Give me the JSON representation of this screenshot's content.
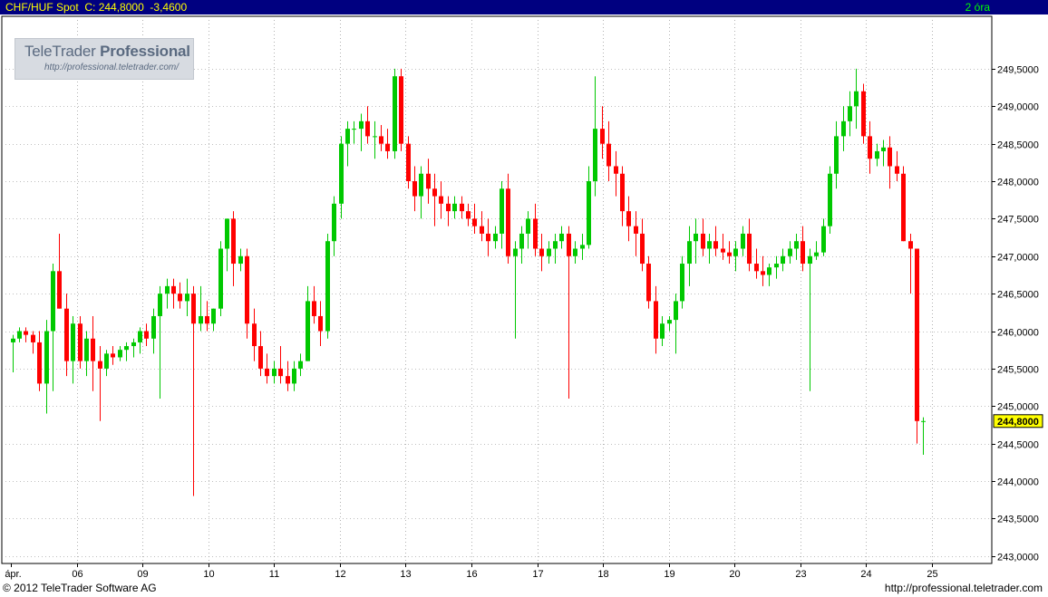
{
  "header": {
    "symbol": "CHF/HUF Spot",
    "close": "C: 244,8000",
    "change": "-3,4600",
    "interval": "2 óra"
  },
  "watermark": {
    "brand_light": "TeleTrader ",
    "brand_bold": "Professional",
    "url": "http://professional.teletrader.com/"
  },
  "footer": {
    "copyright": "© 2012  TeleTrader Software AG",
    "site": "http://professional.teletrader.com"
  },
  "colors": {
    "header_bg": "#000080",
    "header_text": "#ffff00",
    "up": "#00c800",
    "down": "#ff0000",
    "grid": "#808080",
    "axis_bg": "#ffffff",
    "last_price_bg": "#ffff00"
  },
  "chart_data": {
    "type": "candlestick",
    "title": "CHF/HUF Spot",
    "interval": "2 óra",
    "x_ticks": [
      "ápr.",
      "06",
      "09",
      "10",
      "11",
      "12",
      "13",
      "16",
      "17",
      "18",
      "19",
      "20",
      "23",
      "24",
      "25"
    ],
    "y_ticks": [
      "243,0000",
      "243,5000",
      "244,0000",
      "244,5000",
      "245,0000",
      "245,5000",
      "246,0000",
      "246,5000",
      "247,0000",
      "247,5000",
      "248,0000",
      "248,5000",
      "249,0000",
      "249,5000"
    ],
    "y_tick_values": [
      243.0,
      243.5,
      244.0,
      244.5,
      245.0,
      245.5,
      246.0,
      246.5,
      247.0,
      247.5,
      248.0,
      248.5,
      249.0,
      249.5
    ],
    "ylim": [
      242.9,
      250.2
    ],
    "last_price": 244.8,
    "last_price_label": "244,8000",
    "grid": true,
    "candles": [
      [
        245.85,
        245.95,
        245.45,
        245.9
      ],
      [
        245.9,
        246.05,
        245.85,
        246.0
      ],
      [
        246.0,
        246.05,
        245.85,
        245.95
      ],
      [
        245.95,
        246.0,
        245.7,
        245.85
      ],
      [
        245.85,
        246.0,
        245.2,
        245.3
      ],
      [
        245.3,
        246.15,
        244.9,
        246.0
      ],
      [
        246.0,
        246.9,
        245.2,
        246.8
      ],
      [
        246.8,
        247.3,
        246.3,
        246.3
      ],
      [
        246.3,
        246.5,
        245.4,
        245.6
      ],
      [
        245.6,
        246.2,
        245.3,
        246.1
      ],
      [
        246.1,
        246.2,
        245.5,
        245.6
      ],
      [
        245.6,
        246.0,
        245.4,
        245.9
      ],
      [
        245.9,
        246.2,
        245.2,
        245.6
      ],
      [
        245.6,
        245.8,
        244.8,
        245.5
      ],
      [
        245.5,
        245.75,
        245.4,
        245.7
      ],
      [
        245.7,
        245.8,
        245.55,
        245.65
      ],
      [
        245.65,
        245.8,
        245.6,
        245.75
      ],
      [
        245.75,
        245.85,
        245.6,
        245.8
      ],
      [
        245.8,
        245.9,
        245.65,
        245.85
      ],
      [
        245.85,
        246.05,
        245.7,
        246.0
      ],
      [
        246.0,
        246.1,
        245.8,
        245.9
      ],
      [
        245.9,
        246.3,
        245.7,
        246.2
      ],
      [
        246.2,
        246.6,
        245.1,
        246.5
      ],
      [
        246.5,
        246.7,
        246.3,
        246.6
      ],
      [
        246.6,
        246.7,
        246.3,
        246.5
      ],
      [
        246.5,
        246.65,
        246.3,
        246.4
      ],
      [
        246.4,
        246.7,
        246.2,
        246.5
      ],
      [
        246.5,
        246.6,
        243.8,
        246.1
      ],
      [
        246.1,
        246.6,
        246.0,
        246.2
      ],
      [
        246.2,
        246.4,
        246.0,
        246.1
      ],
      [
        246.1,
        246.3,
        246.0,
        246.3
      ],
      [
        246.3,
        247.2,
        246.2,
        247.1
      ],
      [
        247.1,
        247.5,
        246.8,
        247.5
      ],
      [
        247.5,
        247.6,
        246.6,
        246.9
      ],
      [
        246.9,
        247.1,
        246.8,
        247.0
      ],
      [
        247.0,
        247.1,
        245.9,
        246.1
      ],
      [
        246.1,
        246.3,
        245.6,
        245.8
      ],
      [
        245.8,
        246.0,
        245.4,
        245.5
      ],
      [
        245.5,
        245.7,
        245.3,
        245.4
      ],
      [
        245.4,
        245.6,
        245.3,
        245.5
      ],
      [
        245.5,
        245.8,
        245.3,
        245.4
      ],
      [
        245.4,
        245.6,
        245.2,
        245.3
      ],
      [
        245.3,
        245.6,
        245.2,
        245.5
      ],
      [
        245.5,
        245.7,
        245.4,
        245.6
      ],
      [
        245.6,
        246.6,
        245.6,
        246.4
      ],
      [
        246.4,
        246.6,
        246.1,
        246.2
      ],
      [
        246.2,
        246.4,
        245.8,
        246.0
      ],
      [
        246.0,
        247.3,
        245.9,
        247.2
      ],
      [
        247.2,
        247.8,
        247.0,
        247.7
      ],
      [
        247.7,
        248.6,
        247.5,
        248.5
      ],
      [
        248.5,
        248.8,
        248.2,
        248.7
      ],
      [
        248.7,
        248.8,
        248.5,
        248.7
      ],
      [
        248.7,
        248.9,
        248.4,
        248.8
      ],
      [
        248.8,
        249.0,
        248.5,
        248.6
      ],
      [
        248.6,
        248.8,
        248.3,
        248.6
      ],
      [
        248.6,
        248.75,
        248.4,
        248.5
      ],
      [
        248.5,
        248.7,
        248.3,
        248.4
      ],
      [
        248.4,
        249.5,
        248.3,
        249.4
      ],
      [
        249.4,
        249.5,
        248.4,
        248.5
      ],
      [
        248.5,
        248.6,
        247.9,
        248.0
      ],
      [
        248.0,
        248.2,
        247.6,
        247.8
      ],
      [
        247.8,
        248.2,
        247.5,
        248.1
      ],
      [
        248.1,
        248.3,
        247.7,
        247.9
      ],
      [
        247.9,
        248.1,
        247.4,
        247.8
      ],
      [
        247.8,
        248.0,
        247.5,
        247.7
      ],
      [
        247.7,
        247.8,
        247.4,
        247.6
      ],
      [
        247.6,
        247.8,
        247.5,
        247.7
      ],
      [
        247.7,
        247.8,
        247.5,
        247.6
      ],
      [
        247.6,
        247.7,
        247.4,
        247.5
      ],
      [
        247.5,
        247.7,
        247.3,
        247.4
      ],
      [
        247.4,
        247.6,
        247.2,
        247.3
      ],
      [
        247.3,
        247.5,
        247.0,
        247.2
      ],
      [
        247.2,
        247.4,
        247.1,
        247.3
      ],
      [
        247.3,
        248.0,
        247.1,
        247.9
      ],
      [
        247.9,
        248.1,
        246.9,
        247.0
      ],
      [
        247.0,
        247.2,
        245.9,
        247.1
      ],
      [
        247.1,
        247.4,
        246.9,
        247.3
      ],
      [
        247.3,
        247.6,
        247.1,
        247.5
      ],
      [
        247.5,
        247.7,
        247.0,
        247.1
      ],
      [
        247.1,
        247.3,
        246.8,
        247.0
      ],
      [
        247.0,
        247.2,
        246.9,
        247.1
      ],
      [
        247.1,
        247.3,
        246.9,
        247.2
      ],
      [
        247.2,
        247.4,
        247.1,
        247.3
      ],
      [
        247.3,
        247.4,
        245.1,
        247.0
      ],
      [
        247.0,
        247.2,
        246.9,
        247.1
      ],
      [
        247.1,
        247.3,
        246.95,
        247.15
      ],
      [
        247.15,
        248.2,
        247.1,
        248.0
      ],
      [
        248.0,
        249.4,
        247.8,
        248.7
      ],
      [
        248.7,
        249.0,
        248.3,
        248.5
      ],
      [
        248.5,
        248.8,
        248.0,
        248.2
      ],
      [
        248.2,
        248.4,
        247.8,
        248.1
      ],
      [
        248.1,
        248.2,
        247.4,
        247.6
      ],
      [
        247.6,
        247.8,
        247.2,
        247.4
      ],
      [
        247.4,
        247.6,
        247.0,
        247.3
      ],
      [
        247.3,
        247.5,
        246.8,
        246.9
      ],
      [
        246.9,
        247.0,
        246.3,
        246.4
      ],
      [
        246.4,
        246.6,
        245.7,
        245.9
      ],
      [
        245.9,
        246.2,
        245.8,
        246.1
      ],
      [
        246.1,
        246.2,
        246.0,
        246.15
      ],
      [
        246.15,
        246.5,
        245.7,
        246.4
      ],
      [
        246.4,
        247.0,
        246.3,
        246.9
      ],
      [
        246.9,
        247.4,
        246.6,
        247.2
      ],
      [
        247.2,
        247.5,
        246.9,
        247.3
      ],
      [
        247.3,
        247.5,
        247.0,
        247.1
      ],
      [
        247.1,
        247.3,
        246.9,
        247.2
      ],
      [
        247.2,
        247.4,
        247.0,
        247.1
      ],
      [
        247.1,
        247.3,
        246.95,
        247.05
      ],
      [
        247.05,
        247.2,
        246.9,
        247.0
      ],
      [
        247.0,
        247.2,
        246.8,
        247.1
      ],
      [
        247.1,
        247.4,
        247.0,
        247.3
      ],
      [
        247.3,
        247.5,
        246.8,
        246.9
      ],
      [
        246.9,
        247.1,
        246.7,
        246.8
      ],
      [
        246.8,
        247.0,
        246.6,
        246.75
      ],
      [
        246.75,
        246.9,
        246.6,
        246.85
      ],
      [
        246.85,
        247.0,
        246.7,
        246.9
      ],
      [
        246.9,
        247.1,
        246.8,
        247.0
      ],
      [
        247.0,
        247.2,
        246.9,
        247.1
      ],
      [
        247.1,
        247.3,
        246.95,
        247.2
      ],
      [
        247.2,
        247.4,
        246.8,
        246.9
      ],
      [
        246.9,
        247.1,
        245.2,
        247.0
      ],
      [
        247.0,
        247.2,
        246.95,
        247.05
      ],
      [
        247.05,
        247.5,
        247.0,
        247.4
      ],
      [
        247.4,
        248.2,
        247.3,
        248.1
      ],
      [
        248.1,
        248.8,
        247.9,
        248.6
      ],
      [
        248.6,
        249.0,
        248.4,
        248.8
      ],
      [
        248.8,
        249.2,
        248.6,
        249.0
      ],
      [
        249.0,
        249.5,
        248.7,
        249.2
      ],
      [
        249.2,
        249.3,
        248.5,
        248.6
      ],
      [
        248.6,
        248.8,
        248.1,
        248.3
      ],
      [
        248.3,
        248.5,
        248.2,
        248.4
      ],
      [
        248.4,
        248.55,
        248.2,
        248.45
      ],
      [
        248.45,
        248.6,
        247.9,
        248.2
      ],
      [
        248.2,
        248.4,
        248.0,
        248.1
      ],
      [
        248.1,
        248.2,
        247.2,
        247.2
      ],
      [
        247.2,
        247.3,
        246.5,
        247.1
      ],
      [
        247.1,
        247.1,
        244.5,
        244.8
      ],
      [
        244.8,
        244.85,
        244.35,
        244.8
      ]
    ]
  }
}
